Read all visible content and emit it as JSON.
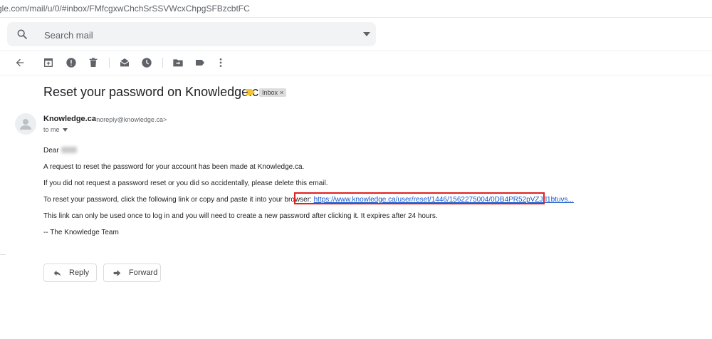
{
  "browser": {
    "url": "gle.com/mail/u/0/#inbox/FMfcgxwChchSrSSVWcxChpgSFBzcbtFC"
  },
  "search": {
    "placeholder": "Search mail",
    "icon": "search-icon",
    "options_icon": "dropdown-caret-icon"
  },
  "toolbar": {
    "icons": [
      "back-arrow-icon",
      "archive-icon",
      "report-spam-icon",
      "delete-icon",
      "mark-unread-icon",
      "snooze-icon",
      "move-to-icon",
      "label-icon",
      "more-vert-icon"
    ]
  },
  "email": {
    "subject": "Reset your password on Knowledge.ca",
    "importance_color": "#f4c430",
    "label": "Inbox",
    "label_close": "×",
    "sender_name": "Knowledge.ca",
    "sender_email": "<noreply@knowledge.ca>",
    "to": "to me",
    "greeting": "Dear",
    "paragraph1": "A request to reset the password for your account has been made at Knowledge.ca.",
    "paragraph2": "If you did not request a password reset or you did so accidentally, please delete this email.",
    "paragraph3_prefix": "To reset your password, click the following link or copy and paste it into your browser:",
    "reset_link": "https://www.knowledge.ca/user/reset/1446/1562275004/0DB4PR52pVZJrl1btuvs...",
    "paragraph4": "This link can only be used once to log in and you will need to create a new password after clicking it. It expires after 24 hours.",
    "signature": "-- The Knowledge Team"
  },
  "actions": {
    "reply_label": "Reply",
    "forward_label": "Forward"
  },
  "colors": {
    "link": "#1155cc",
    "highlight_border": "#e02020",
    "search_bg": "#f1f3f4"
  }
}
